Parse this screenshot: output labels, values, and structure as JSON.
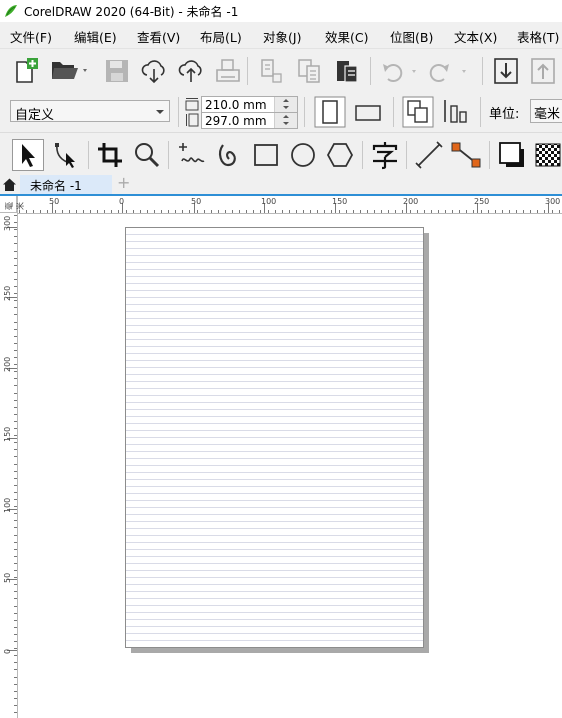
{
  "window": {
    "title": "CorelDRAW 2020 (64-Bit) - 未命名 -1"
  },
  "menu": [
    "文件(F)",
    "编辑(E)",
    "查看(V)",
    "布局(L)",
    "对象(J)",
    "效果(C)",
    "位图(B)",
    "文本(X)",
    "表格(T)"
  ],
  "property_bar": {
    "page_preset": "自定义",
    "width": "210.0 mm",
    "height": "297.0 mm",
    "unit_label": "单位:",
    "unit_value": "毫米"
  },
  "tabs": {
    "document": "未命名 -1",
    "add": "+"
  },
  "ruler": {
    "h_labels": [
      "50",
      "0",
      "50",
      "100",
      "150",
      "200",
      "250",
      "300"
    ],
    "v_labels": [
      "300",
      "250",
      "200",
      "150",
      "100",
      "50",
      "0"
    ],
    "unit_mark": "毫米"
  },
  "icons": {
    "standard": [
      "new-document-icon",
      "open-folder-icon",
      "save-icon",
      "cloud-import-icon",
      "cloud-export-icon",
      "print-icon",
      "import-icon",
      "export-icon",
      "publish-pdf-icon",
      "undo-icon",
      "redo-icon",
      "download-icon",
      "upload-icon"
    ],
    "tools": [
      "pick-tool-icon",
      "shape-tool-icon",
      "crop-tool-icon",
      "zoom-tool-icon",
      "freehand-tool-icon",
      "artistic-media-icon",
      "rectangle-tool-icon",
      "ellipse-tool-icon",
      "polygon-tool-icon",
      "text-tool-icon",
      "dimension-tool-icon",
      "connector-tool-icon",
      "drop-shadow-icon",
      "transparency-icon"
    ]
  },
  "colors": {
    "accent": "#2e8fd6",
    "logo": "#3fae2a",
    "node_orange": "#e0661a"
  }
}
